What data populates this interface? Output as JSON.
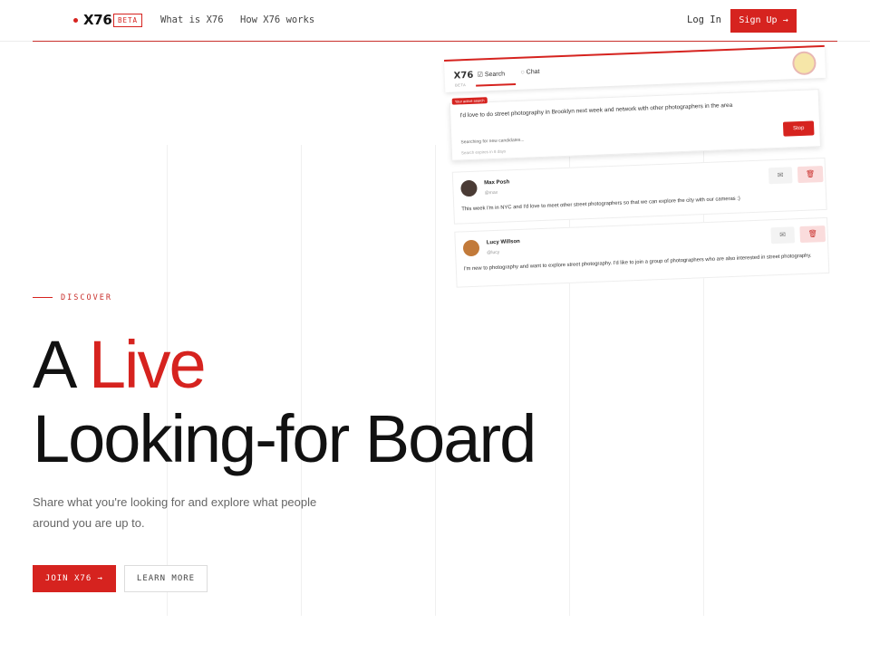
{
  "nav": {
    "logo": "X76",
    "beta": "BETA",
    "links": [
      "What is X76",
      "How X76 works"
    ],
    "login": "Log In",
    "signup": "Sign Up →"
  },
  "hero": {
    "eyebrow": "DISCOVER",
    "headline_part1": "A",
    "headline_accent": "Live",
    "headline_line2": "Looking-for Board",
    "subtitle": "Share what you're looking for and explore what people around you are up to.",
    "cta_primary": "JOIN X76 →",
    "cta_secondary": "LEARN MORE"
  },
  "preview": {
    "logo": "X76",
    "beta": "BETA",
    "tabs": [
      "Search",
      "Chat"
    ],
    "search": {
      "pill": "Your active search",
      "query": "I'd love to do street photography in Brooklyn next week and network with other photographers in the area",
      "status": "Searching for new candidates...",
      "expires": "Search expires in 8 days",
      "stop_label": "Stop"
    },
    "candidates": [
      {
        "name": "Max Posh",
        "handle": "@max",
        "message": "This week I'm in NYC and I'd love to meet other street photographers so that we can explore the city with our cameras :)"
      },
      {
        "name": "Lucy Willson",
        "handle": "@lucy",
        "message": "I'm new to photography and want to explore street photography. I'd like to join a group of photographers who are also interested in street photography."
      }
    ]
  },
  "colors": {
    "accent": "#d6231f",
    "text": "#111111",
    "muted": "#666666"
  }
}
